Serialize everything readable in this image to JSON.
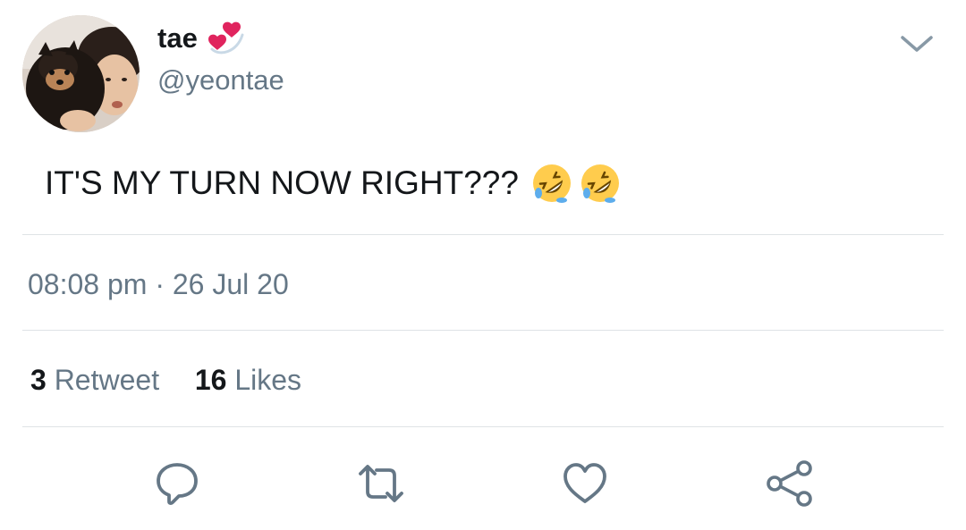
{
  "user": {
    "display_name": "tae",
    "handle": "@yeontae",
    "name_emoji": "revolving-hearts-emoji"
  },
  "tweet": {
    "text": "IT'S MY TURN NOW RIGHT???",
    "emojis": [
      "rolling-on-floor-laughing-emoji",
      "rolling-on-floor-laughing-emoji"
    ]
  },
  "meta": {
    "time": "08:08 pm",
    "separator": "·",
    "date": "26 Jul 20"
  },
  "stats": {
    "retweets_count": "3",
    "retweets_label": "Retweet",
    "likes_count": "16",
    "likes_label": "Likes"
  },
  "actions": {
    "reply": "reply-icon",
    "retweet": "retweet-icon",
    "like": "heart-icon",
    "share": "share-icon"
  },
  "colors": {
    "text_primary": "#14171a",
    "text_secondary": "#657786",
    "divider": "#dfe3e6",
    "heart_emoji": "#e0245e",
    "laugh_emoji": "#ffcc4d"
  }
}
